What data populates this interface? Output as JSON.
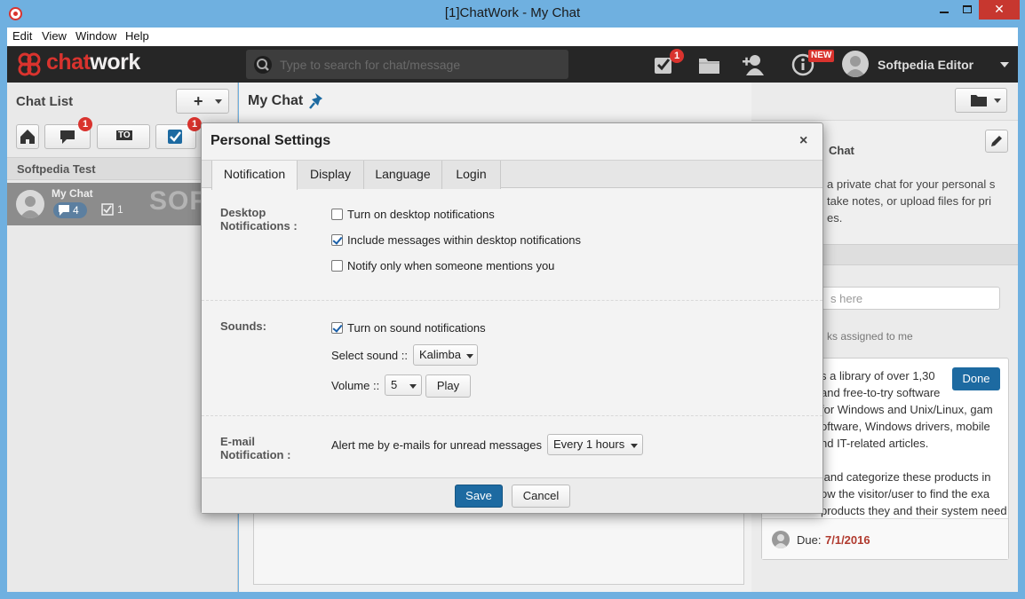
{
  "window": {
    "title": "[1]ChatWork - My Chat",
    "minimize": "",
    "close": "✕"
  },
  "menu": [
    "Edit",
    "View",
    "Window",
    "Help"
  ],
  "header": {
    "logo_chat": "chat",
    "logo_work": "work",
    "search_placeholder": "Type to search for chat/message",
    "task_badge": "1",
    "new_badge": "NEW",
    "user_name": "Softpedia Editor"
  },
  "left": {
    "title": "Chat List",
    "add_label": "+",
    "filter_badges": [
      "1",
      "1"
    ],
    "filter_to_label": "TO",
    "group": "Softpedia Test",
    "chat": {
      "name": "My Chat",
      "messages": "4",
      "tasks": "1"
    },
    "watermark": "SOFTPEDIA"
  },
  "center": {
    "title": "My Chat"
  },
  "right": {
    "title": "Chat",
    "description": "a private chat for your personal s\ntake notes, or upload files for pri\nes.",
    "search_placeholder": "s here",
    "assigned": "ks assigned to me",
    "task_text": "s a library of over 1,30\nand free-to-try software\nfor Windows and Unix/Linux, gam\noftware, Windows drivers, mobile\nnd IT-related articles.\n\n and categorize these products in\now the visitor/user to find the exa\nproducts they and their system needs.",
    "done_label": "Done",
    "due_label": "Due:",
    "due_date": "7/1/2016"
  },
  "modal": {
    "title": "Personal Settings",
    "close": "×",
    "tabs": [
      "Notification",
      "Display",
      "Language",
      "Login"
    ],
    "desktop": {
      "label_1": "Desktop",
      "label_2": "Notifications :",
      "options": [
        {
          "label": "Turn on desktop notifications",
          "checked": false
        },
        {
          "label": "Include messages within desktop notifications",
          "checked": true
        },
        {
          "label": "Notify only when someone mentions you",
          "checked": false
        }
      ]
    },
    "sounds": {
      "label": "Sounds:",
      "turn_on": "Turn on sound notifications",
      "turn_on_checked": true,
      "select_label": "Select sound ::",
      "sound_value": "Kalimba",
      "volume_label": "Volume ::",
      "volume_value": "5",
      "play_label": "Play"
    },
    "email": {
      "label_1": "E-mail",
      "label_2": "Notification :",
      "text": "Alert me by e-mails for unread messages",
      "interval": "Every 1 hours"
    },
    "save_label": "Save",
    "cancel_label": "Cancel"
  },
  "colors": {
    "brand_red": "#d9332e",
    "primary_blue": "#1d6aa1",
    "header_dark": "#262626",
    "frame_blue": "#6fb0e0"
  }
}
